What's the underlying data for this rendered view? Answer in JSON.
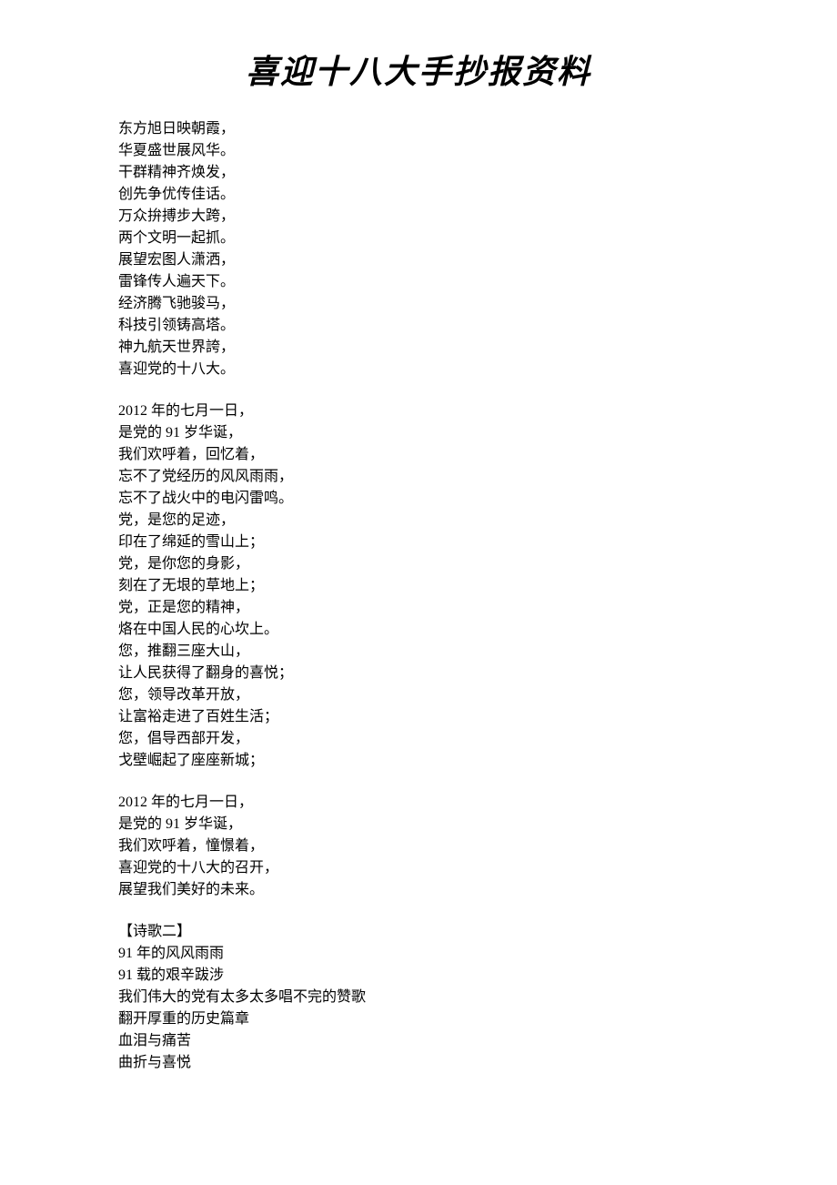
{
  "title": "喜迎十八大手抄报资料",
  "stanzas": [
    {
      "lines": [
        "东方旭日映朝霞，",
        "华夏盛世展风华。",
        "干群精神齐焕发，",
        "创先争优传佳话。",
        "万众拚搏步大跨，",
        "两个文明一起抓。",
        "展望宏图人潇洒，",
        "雷锋传人遍天下。",
        "经济腾飞驰骏马，",
        "科技引领铸高塔。",
        "神九航天世界誇，",
        "喜迎党的十八大。"
      ]
    },
    {
      "lines": [
        "2012 年的七月一日，",
        "是党的 91 岁华诞，",
        "我们欢呼着，回忆着，",
        "忘不了党经历的风风雨雨，",
        "忘不了战火中的电闪雷鸣。",
        "党，是您的足迹，",
        "印在了绵延的雪山上；",
        "党，是你您的身影，",
        "刻在了无垠的草地上；",
        "党，正是您的精神，",
        "烙在中国人民的心坎上。",
        "您，推翻三座大山，",
        "让人民获得了翻身的喜悦；",
        "您，领导改革开放，",
        "让富裕走进了百姓生活；",
        "您，倡导西部开发，",
        "戈壁崛起了座座新城；"
      ]
    },
    {
      "lines": [
        "2012 年的七月一日，",
        "是党的 91 岁华诞，",
        "我们欢呼着，憧憬着，",
        "喜迎党的十八大的召开，",
        "展望我们美好的未来。"
      ]
    },
    {
      "lines": [
        "【诗歌二】",
        "91 年的风风雨雨",
        "91 载的艰辛跋涉",
        "我们伟大的党有太多太多唱不完的赞歌",
        "翻开厚重的历史篇章",
        "血泪与痛苦",
        "曲折与喜悦"
      ]
    }
  ]
}
